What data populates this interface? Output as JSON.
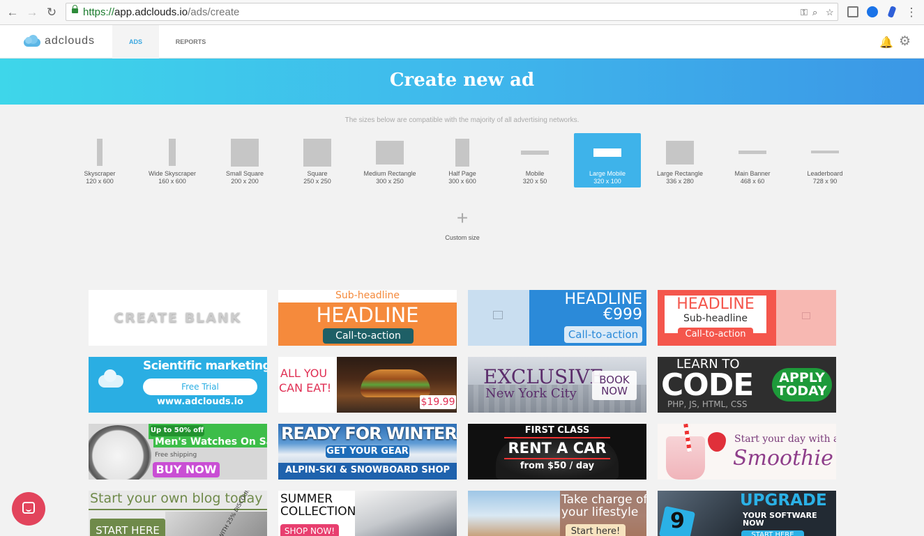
{
  "browser": {
    "url_scheme": "https://",
    "url_host": "app.adclouds.io",
    "url_path": "/ads/create"
  },
  "app": {
    "logo_text": "adclouds",
    "tabs": [
      {
        "label": "ADS",
        "active": true
      },
      {
        "label": "REPORTS",
        "active": false
      }
    ]
  },
  "hero": {
    "title": "Create new ad"
  },
  "note": "The sizes below are compatible with the majority of all advertising networks.",
  "sizes": [
    {
      "name": "Skyscraper",
      "dims": "120 x 600"
    },
    {
      "name": "Wide Skyscraper",
      "dims": "160 x 600"
    },
    {
      "name": "Small Square",
      "dims": "200 x 200"
    },
    {
      "name": "Square",
      "dims": "250 x 250"
    },
    {
      "name": "Medium Rectangle",
      "dims": "300 x 250"
    },
    {
      "name": "Half Page",
      "dims": "300 x 600"
    },
    {
      "name": "Mobile",
      "dims": "320 x 50"
    },
    {
      "name": "Large Mobile",
      "dims": "320 x 100",
      "selected": true
    },
    {
      "name": "Large Rectangle",
      "dims": "336 x 280"
    },
    {
      "name": "Main Banner",
      "dims": "468 x 60"
    },
    {
      "name": "Leaderboard",
      "dims": "728 x 90"
    }
  ],
  "custom": {
    "label": "Custom size"
  },
  "templates": {
    "blank": "CREATE BLANK",
    "t2": {
      "sub": "Sub-headline",
      "head": "HEADLINE",
      "cta": "Call-to-action"
    },
    "t3": {
      "head": "HEADLINE",
      "price": "€999",
      "cta": "Call-to-action"
    },
    "t4": {
      "head": "HEADLINE",
      "sub": "Sub-headline",
      "cta": "Call-to-action"
    },
    "t5": {
      "title": "Scientific marketing",
      "btn": "Free Trial",
      "url": "www.adclouds.io"
    },
    "t6": {
      "line1": "ALL YOU",
      "line2": "CAN EAT!",
      "price": "$19.99"
    },
    "t7": {
      "head": "EXCLUSIVE",
      "sub": "New York City",
      "btn1": "BOOK",
      "btn2": "NOW"
    },
    "t8": {
      "line1": "LEARN TO",
      "line2": "CODE",
      "langs": "PHP, JS, HTML, CSS",
      "btn1": "APPLY",
      "btn2": "TODAY"
    },
    "t9": {
      "badge": "Up to 50% off",
      "head": "Men's Watches  On Sale",
      "sub": "Free shipping",
      "btn": "BUY NOW"
    },
    "t10": {
      "head": "READY FOR WINTER?",
      "cta": "GET YOUR GEAR",
      "shop": "ALPIN-SKI & SNOWBOARD SHOP"
    },
    "t11": {
      "line1": "FIRST CLASS",
      "line2": "RENT A CAR",
      "line3": "from $50 / day"
    },
    "t12": {
      "line1": "Start your day with a",
      "line2": "Smoothie"
    },
    "t13": {
      "head": "Start your own blog today",
      "btn": "START HERE",
      "tag": "NOW WITH 25% DISCOUNT"
    },
    "t14": {
      "line1": "SUMMER",
      "line2": "COLLECTION",
      "btn": "SHOP NOW!"
    },
    "t15": {
      "line1": "Take charge of",
      "line2": "your lifestyle",
      "btn": "Start here!"
    },
    "t16": {
      "head": "UPGRADE",
      "sub1": "YOUR SOFTWARE",
      "sub2": "NOW",
      "btn": "START HERE",
      "badge": "9"
    }
  },
  "colors": {
    "accent": "#3eb3ea",
    "hero_start": "#3ed6ea",
    "hero_end": "#3b97e6"
  }
}
